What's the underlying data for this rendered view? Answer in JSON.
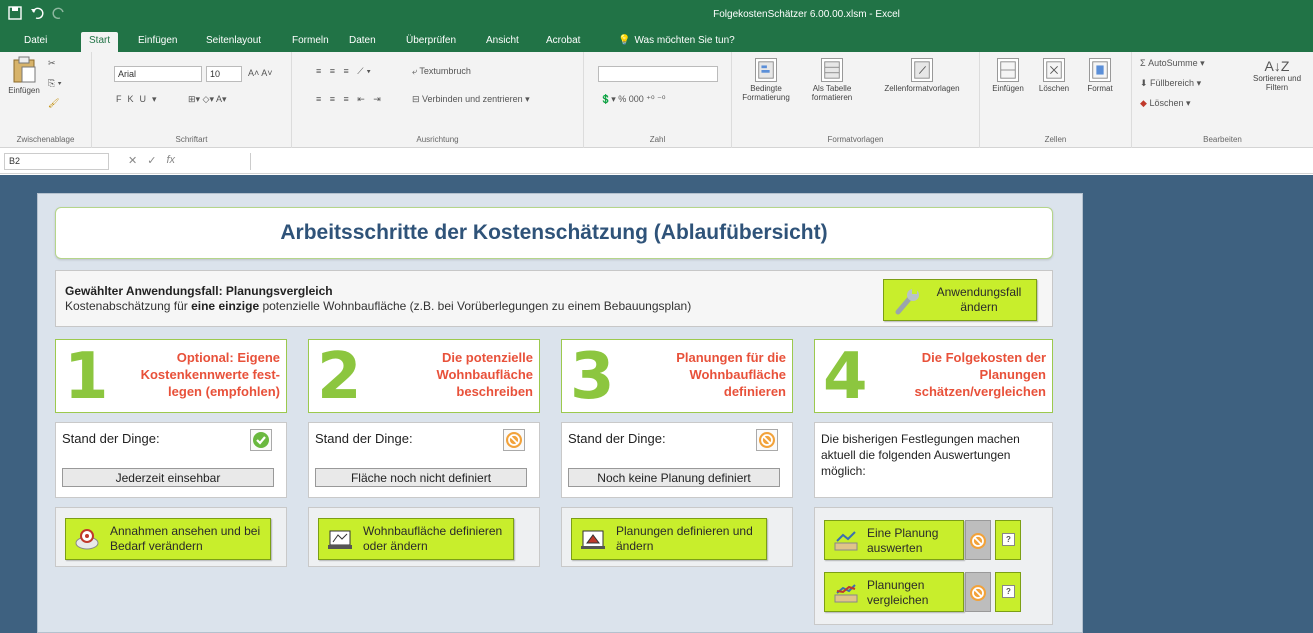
{
  "window": {
    "title": "FolgekostenSchätzer 6.00.00.xlsm - Excel"
  },
  "tabs": [
    "Datei",
    "Start",
    "Einfügen",
    "Seitenlayout",
    "Formeln",
    "Daten",
    "Überprüfen",
    "Ansicht",
    "Acrobat"
  ],
  "active_tab": "Start",
  "tellme": "Was möchten Sie tun?",
  "ribbon": {
    "clipboard": {
      "paste": "Einfügen",
      "label": "Zwischenablage"
    },
    "font": {
      "name": "Arial",
      "size": "10",
      "label": "Schriftart"
    },
    "alignment": {
      "wrap": "Textumbruch",
      "merge": "Verbinden und zentrieren",
      "label": "Ausrichtung"
    },
    "number": {
      "label": "Zahl"
    },
    "styles": {
      "conditional": "Bedingte Formatierung",
      "table": "Als Tabelle formatieren",
      "cell_styles": "Zellenformatvorlagen",
      "label": "Formatvorlagen"
    },
    "cells": {
      "insert": "Einfügen",
      "delete": "Löschen",
      "format": "Format",
      "label": "Zellen"
    },
    "editing": {
      "autosum": "AutoSumme",
      "fill": "Füllbereich",
      "clear": "Löschen",
      "sort": "Sortieren und Filtern",
      "label": "Bearbeiten"
    }
  },
  "formula_bar": {
    "name_box": "B2",
    "fx": "fx"
  },
  "sheet": {
    "title": "Arbeitsschritte der Kostenschätzung (Ablaufübersicht)",
    "usecase_line": "Gewählter Anwendungsfall: Planungsvergleich",
    "usecase_desc_pre": "Kostenabschätzung für ",
    "usecase_desc_bold": "eine einzige",
    "usecase_desc_post": " potenzielle Wohnbaufläche (z.B. bei Vorüberlegungen zu einem Bebauungsplan)",
    "change_button": "Anwendungsfall ändern",
    "steps": [
      {
        "number": "1",
        "title": "Optional: Eigene Kostenkennwerte fest-legen (empfohlen)"
      },
      {
        "number": "2",
        "title": "Die potenzielle Wohnbaufläche beschreiben"
      },
      {
        "number": "3",
        "title": "Planungen für die Wohnbaufläche definieren"
      },
      {
        "number": "4",
        "title": "Die Folgekosten der Planungen schätzen/vergleichen"
      }
    ],
    "status_label": "Stand der Dinge:",
    "status": [
      {
        "value": "Jederzeit einsehbar",
        "state": "ok"
      },
      {
        "value": "Fläche noch nicht definiert",
        "state": "blocked"
      },
      {
        "value": "Noch keine Planung definiert",
        "state": "blocked"
      }
    ],
    "status4_text": "Die bisherigen Festlegungen machen aktuell die folgenden Auswertungen möglich:",
    "actions": [
      "Annahmen ansehen und bei Bedarf verändern",
      "Wohnbaufläche definieren oder ändern",
      "Planungen definieren und ändern"
    ],
    "eval_buttons": [
      "Eine Planung auswerten",
      "Planungen vergleichen"
    ],
    "colors": {
      "accent_green": "#c8ee2c",
      "step_number": "#8cc63f",
      "step_title": "#e8513a",
      "title_blue": "#2f5379",
      "excel_green": "#217346"
    }
  }
}
